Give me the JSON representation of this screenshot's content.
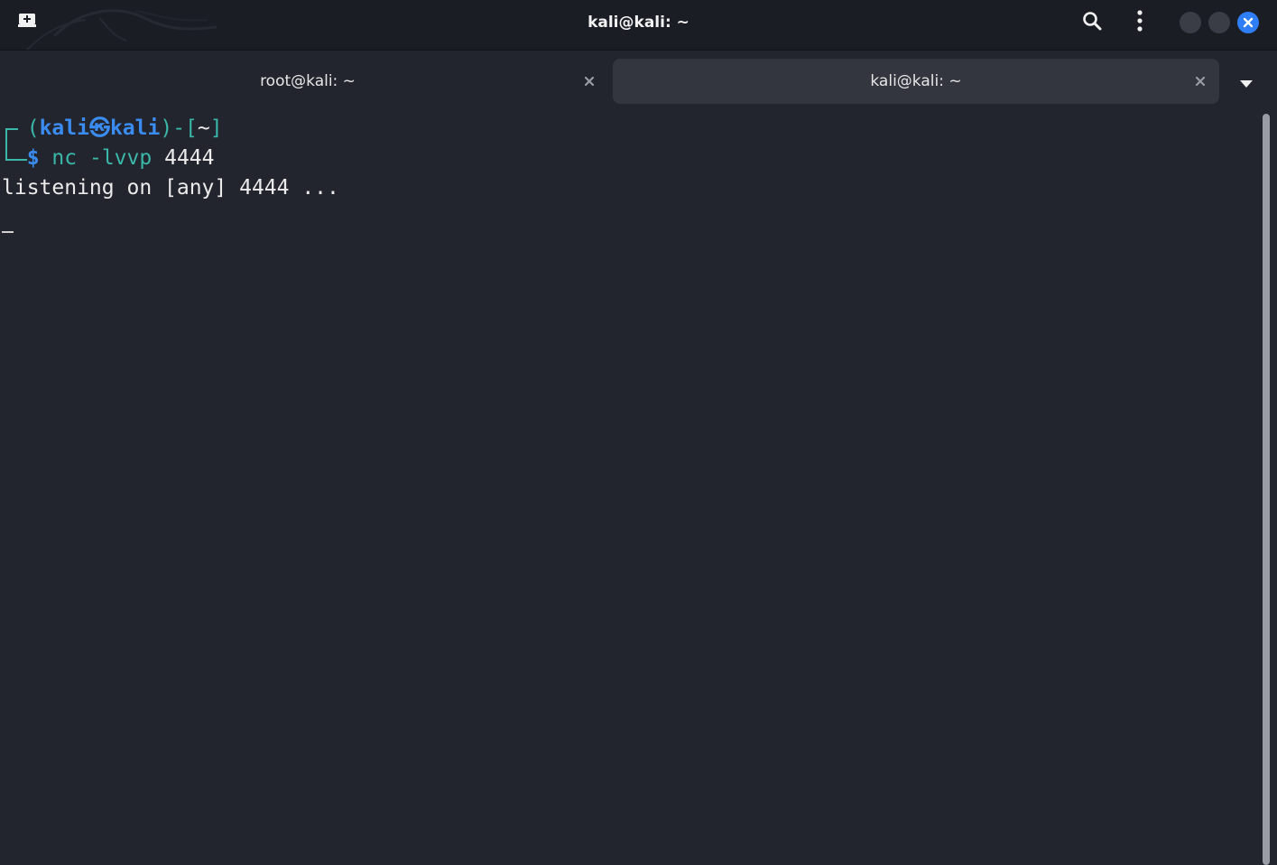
{
  "window": {
    "title": "kali@kali: ~"
  },
  "tabs": [
    {
      "label": "root@kali: ~",
      "active": false
    },
    {
      "label": "kali@kali: ~",
      "active": true
    }
  ],
  "terminal": {
    "prompt": {
      "open": "(",
      "user": "kali",
      "separator": "㉿",
      "host": "kali",
      "close": ")-[",
      "dir": "~",
      "end": "]",
      "symbol": "$"
    },
    "command": {
      "program": "nc",
      "args": "-lvvp",
      "port": "4444"
    },
    "output": [
      "listening on [any] 4444 ..."
    ]
  },
  "colors": {
    "background": "#23252e",
    "header": "#1b1d25",
    "active_tab": "#33363f",
    "prompt_green": "#3ab7a8",
    "prompt_blue": "#3b8cf0",
    "close_button": "#2f7ef5"
  },
  "icons": {
    "new_tab": "new-tab-icon",
    "search": "search-icon",
    "menu": "kebab-menu-icon",
    "minimize": "minimize-icon",
    "maximize": "maximize-icon",
    "close": "close-icon",
    "tab_close": "tab-close-icon",
    "tab_list": "chevron-down-icon"
  }
}
